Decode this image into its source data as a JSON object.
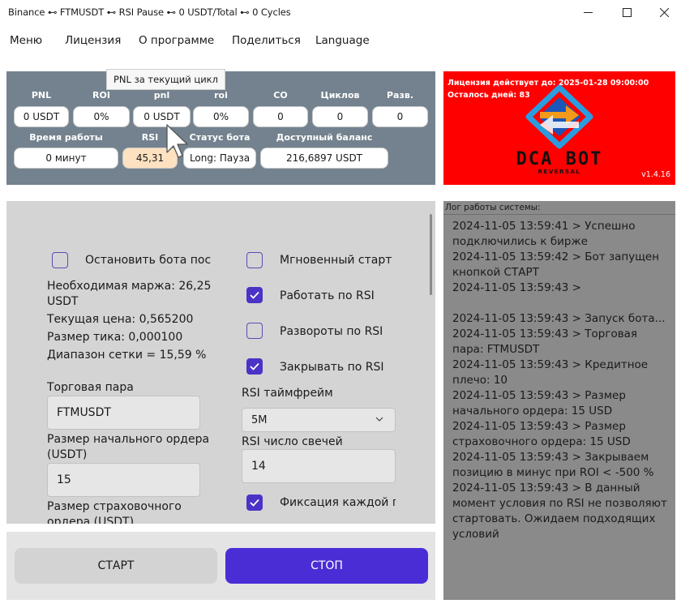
{
  "window": {
    "title": "Binance ⊷ FTMUSDT ⊷ RSI Pause ⊷ 0 USDT/Total ⊷ 0 Cycles"
  },
  "menu": {
    "items": [
      "Меню",
      "Лицензия",
      "О программе",
      "Поделиться",
      "Language"
    ]
  },
  "tooltip": "PNL за текущий цикл",
  "stats": {
    "row1": [
      {
        "label": "PNL",
        "value": "0 USDT"
      },
      {
        "label": "ROI",
        "value": "0%"
      },
      {
        "label": "pnl",
        "value": "0 USDT"
      },
      {
        "label": "roi",
        "value": "0%"
      },
      {
        "label": "CO",
        "value": "0"
      },
      {
        "label": "Циклов",
        "value": "0"
      },
      {
        "label": "Разв.",
        "value": "0"
      }
    ],
    "row2": [
      {
        "label": "Время работы",
        "value": "0 минут"
      },
      {
        "label": "RSI",
        "value": "45,31"
      },
      {
        "label": "Статус бота",
        "value": "Long: Пауза"
      },
      {
        "label": "Доступный баланс",
        "value": "216,6897 USDT"
      }
    ]
  },
  "license": {
    "valid_until": "Лицензия действует до: 2025-01-28 09:00:00",
    "days_left": "Осталось дней: 83",
    "brand": "DCA BOT",
    "brand_sub": "REVERSAL",
    "version": "v1.4.16"
  },
  "settings": {
    "stop_bot": {
      "label": "Остановить бота пос",
      "checked": false
    },
    "margin": "Необходимая маржа: 26,25",
    "margin_unit": "USDT",
    "price": "Текущая цена: 0,565200",
    "tick": "Размер тика: 0,000100",
    "grid": "Диапазон сетки = 15,59 %",
    "pair_label": "Торговая пара",
    "pair_value": "FTMUSDT",
    "initial_order_label_1": "Размер начального ордера",
    "initial_order_label_2": "(USDT)",
    "initial_order_value": "15",
    "safety_order_label_1": "Размер страховочного",
    "safety_order_label_2": "ордера (USDT)",
    "instant_start": {
      "label": "Мгновенный старт",
      "checked": false
    },
    "work_rsi": {
      "label": "Работать по RSI",
      "checked": true
    },
    "reversal_rsi": {
      "label": "Развороты по RSI",
      "checked": false
    },
    "close_rsi": {
      "label": "Закрывать по RSI",
      "checked": true
    },
    "rsi_tf_label": "RSI таймфрейм",
    "rsi_tf_value": "5M",
    "rsi_candles_label": "RSI число свечей",
    "rsi_candles_value": "14",
    "fix_each": {
      "label": "Фиксация каждой гра",
      "checked": true
    }
  },
  "buttons": {
    "start": "СТАРТ",
    "stop": "СТОП"
  },
  "log": {
    "title": "Лог работы системы:",
    "text": "2024-11-05 13:59:41 > Успешно подключились к бирже\n2024-11-05 13:59:42 > Бот запущен кнопкой СТАРТ\n2024-11-05 13:59:43 > \n\n2024-11-05 13:59:43 > Запуск бота...\n2024-11-05 13:59:43 > Торговая пара: FTMUSDT\n2024-11-05 13:59:43 > Кредитное плечо: 10\n2024-11-05 13:59:43 > Размер начального ордера: 15 USD\n2024-11-05 13:59:43 > Размер страховочного ордера: 15 USD\n2024-11-05 13:59:43 > Закрываем позицию в минус при ROI < -500 %\n2024-11-05 13:59:43 > В данный момент условия по RSI не позволяют стартовать. Ожидаем подходящих условий"
  },
  "colors": {
    "stats_bg": "#73828e",
    "banner_bg": "#ff0000",
    "accent": "#4b2dd6",
    "rsi_box": "#fde1c0",
    "log_bg": "#8a8a8a"
  }
}
